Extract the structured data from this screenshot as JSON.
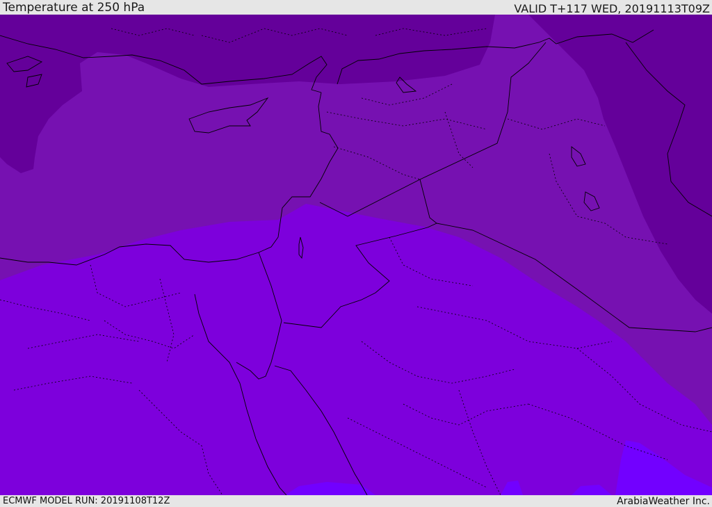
{
  "header": {
    "title": "Temperature at 250 hPa",
    "valid": "VALID T+117 WED, 20191113T09Z"
  },
  "footer": {
    "model_run": "ECMWF MODEL RUN: 20191108T12Z",
    "credit": "ArabiaWeather Inc."
  },
  "colors": {
    "coldest": "#64009a",
    "cold": "#7611b1",
    "mid": "#7d00dc",
    "warm": "#7200ff",
    "border": "#000000"
  }
}
